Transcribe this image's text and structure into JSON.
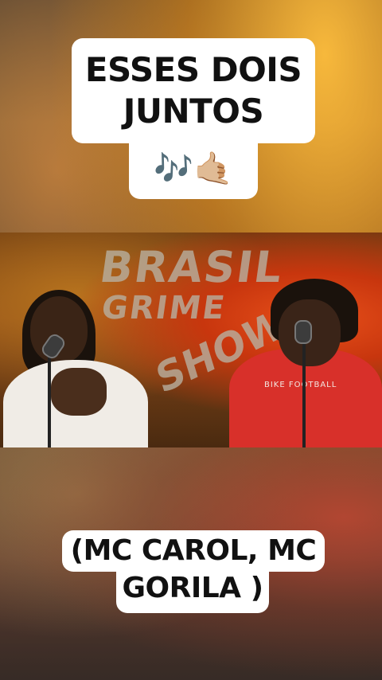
{
  "captions": {
    "top_line_1": "ESSES DOIS",
    "top_line_2": "JUNTOS",
    "emoji": "🎶🤙🏼",
    "bottom_line_1": "(MC CAROL, MC",
    "bottom_line_2": "GORILA )"
  },
  "video": {
    "logo_line_1": "BRASIL",
    "logo_line_2": "GRIME",
    "logo_line_3": "SHOW",
    "shirt_print": "BIKE FOOTBALL",
    "mic_icon": "microphone-icon"
  },
  "colors": {
    "caption_bg": "#ffffff",
    "caption_text": "#111111",
    "shirt_red": "#d8302a"
  }
}
